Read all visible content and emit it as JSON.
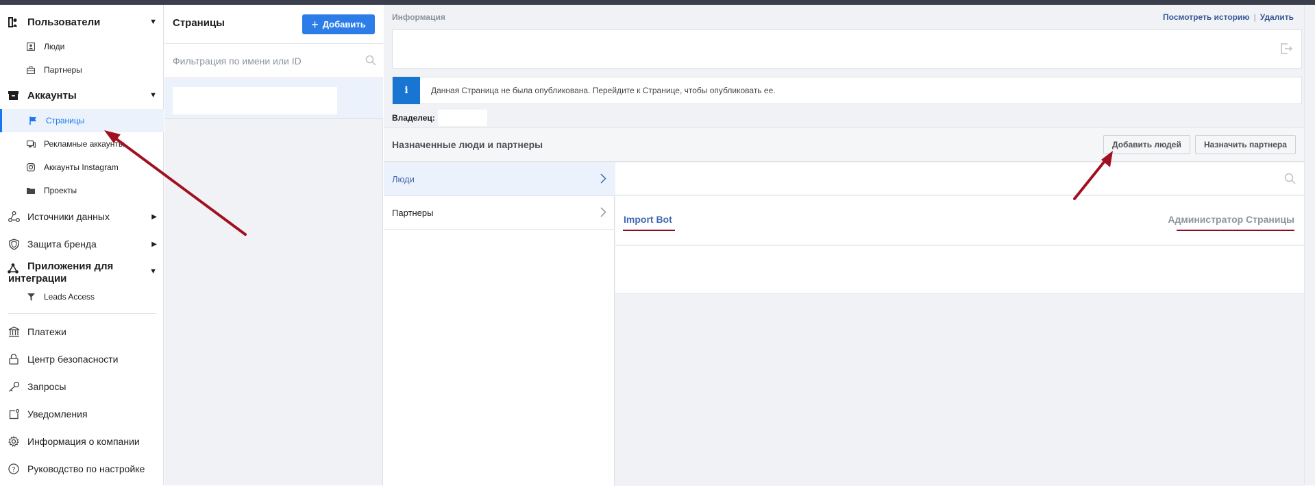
{
  "sidebar": {
    "users_section": "Пользователи",
    "people": "Люди",
    "partners": "Партнеры",
    "accounts_section": "Аккаунты",
    "pages": "Страницы",
    "ad_accounts": "Рекламные аккаунты",
    "instagram": "Аккаунты Instagram",
    "projects": "Проекты",
    "data_sources": "Источники данных",
    "brand_safety": "Защита бренда",
    "integrations": "Приложения для интеграции",
    "leads_access": "Leads Access",
    "payments": "Платежи",
    "security": "Центр безопасности",
    "requests": "Запросы",
    "notifications": "Уведомления",
    "company_info": "Информация о компании",
    "setup_guide": "Руководство по настройке"
  },
  "pages_panel": {
    "title": "Страницы",
    "add_label": "Добавить",
    "filter_placeholder": "Фильтрация по имени или ID"
  },
  "main": {
    "info_label": "Информация",
    "view_history": "Посмотреть историю",
    "separator": "|",
    "delete": "Удалить",
    "notice_icon": "i",
    "notice_text": "Данная Страница не была опубликована. Перейдите к Странице, чтобы опубликовать ее.",
    "owner_label": "Владелец:"
  },
  "assigned": {
    "title": "Назначенные люди и партнеры",
    "add_people": "Добавить людей",
    "assign_partner": "Назначить партнера",
    "tabs": [
      {
        "label": "Люди"
      },
      {
        "label": "Партнеры"
      }
    ],
    "person_name": "Import Bot",
    "person_role": "Администратор Страницы"
  },
  "colors": {
    "accent": "#1877f2",
    "primary_button": "#2d7de9",
    "annotation_arrow": "#a01020"
  }
}
